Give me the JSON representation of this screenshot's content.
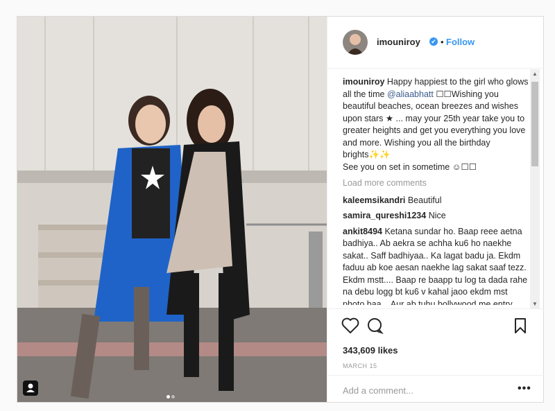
{
  "post": {
    "username": "imouniroy",
    "verified_icon": "✔",
    "separator": "•",
    "follow_label": "Follow",
    "caption": {
      "author": "imouniroy",
      "text_1": "Happy happiest to the girl who glows all the time",
      "mention": "@aliaabhatt",
      "text_2": "☐☐Wishing you beautiful beaches, ocean breezes and wishes upon stars ★ ... may your 25th year take you to greater heights and get you everything you love and more. Wishing you all the birthday brights✨✨",
      "text_3": "See you on set in sometime ☺☐☐"
    },
    "load_more": "Load more comments",
    "comments": [
      {
        "user": "kaleemsikandri",
        "text": "Beautiful"
      },
      {
        "user": "samira_qureshi1234",
        "text": "Nice"
      },
      {
        "user": "ankit8494",
        "text": "Ketana sundar ho. Baap reee aetna badhiya.. Ab aekra se achha ku6 ho naekhe sakat.. Saff badhiyaa.. Ka lagat badu ja. Ekdm faduu ab koe aesan naekhe lag sakat saaf tezz. Ekdm mstt.... Baap re baapp tu log ta dada rahe na debu logg bt ku6 v kahal jaoo ekdm mst photo baa... Aur ab tuhu bollywood me entry kara dher"
      }
    ],
    "likes": "343,609 likes",
    "date": "MARCH 15",
    "add_comment_placeholder": "Add a comment...",
    "more_label": "•••"
  },
  "colors": {
    "accent": "#3897f0",
    "border": "#dbdbdb",
    "muted": "#999999"
  },
  "icons": {
    "like": "heart-icon",
    "comment": "comment-icon",
    "save": "bookmark-icon",
    "tag": "user-tag-icon"
  }
}
